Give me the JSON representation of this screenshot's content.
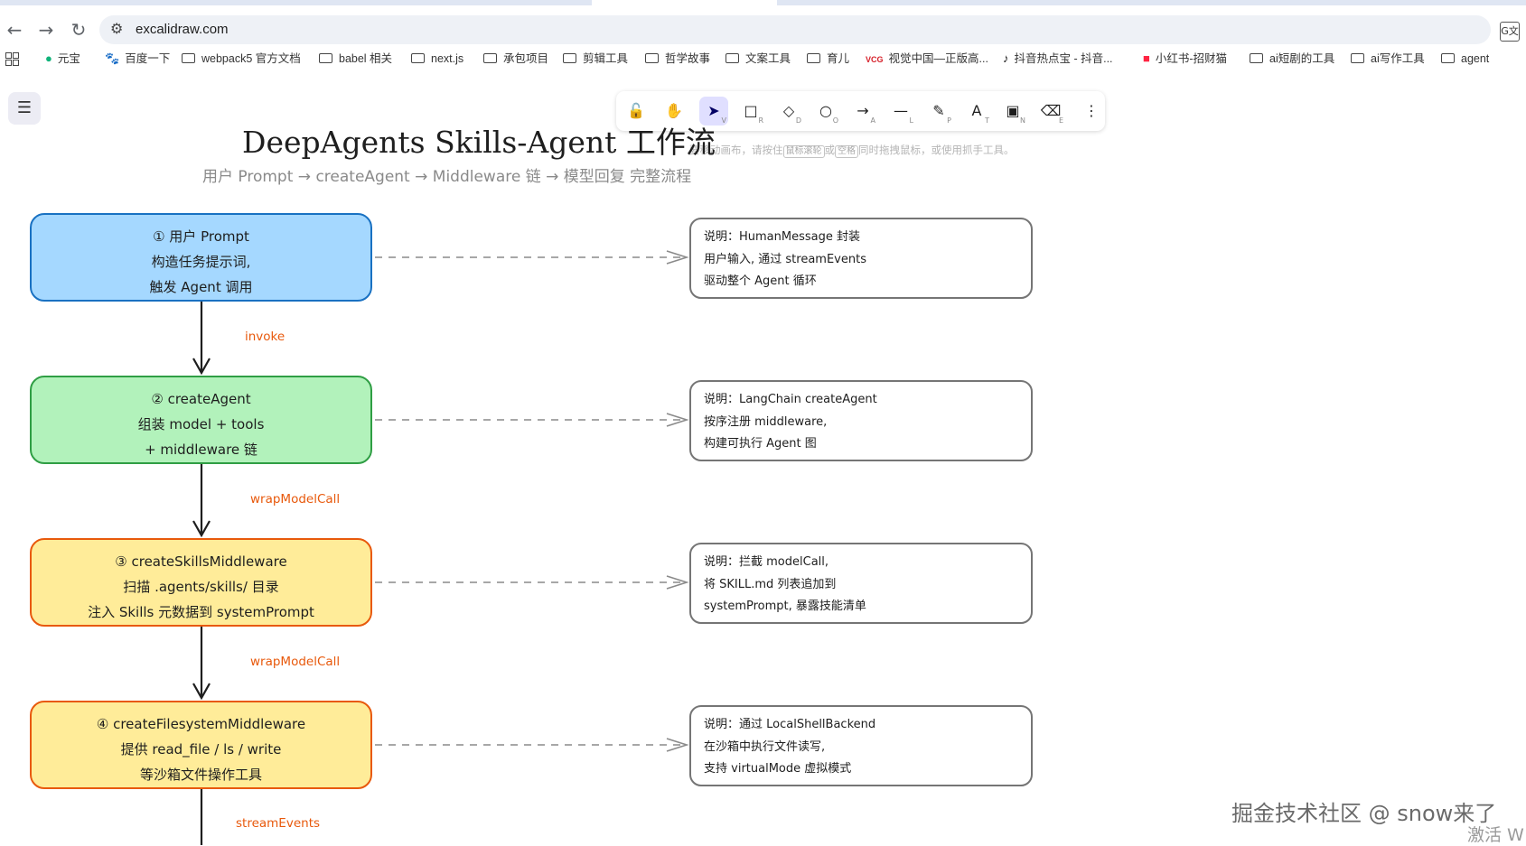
{
  "browser": {
    "url": "excalidraw.com",
    "nav": {
      "back": "←",
      "forward": "→",
      "reload": "↻"
    },
    "translate_icon": "G文",
    "bookmarks": [
      {
        "label": "元宝",
        "icon": "yuanbao-icon"
      },
      {
        "label": "百度一下",
        "icon": "baidu-paw-icon"
      },
      {
        "label": "webpack5 官方文档",
        "icon": "folder-icon"
      },
      {
        "label": "babel 相关",
        "icon": "folder-icon"
      },
      {
        "label": "next.js",
        "icon": "folder-icon"
      },
      {
        "label": "承包项目",
        "icon": "folder-icon"
      },
      {
        "label": "剪辑工具",
        "icon": "folder-icon"
      },
      {
        "label": "哲学故事",
        "icon": "folder-icon"
      },
      {
        "label": "文案工具",
        "icon": "folder-icon"
      },
      {
        "label": "育儿",
        "icon": "folder-icon"
      },
      {
        "label": "视觉中国—正版高...",
        "icon": "vcg-icon",
        "icon_text": "VCG"
      },
      {
        "label": "抖音热点宝 - 抖音...",
        "icon": "douyin-icon"
      },
      {
        "label": "小红书-招财猫",
        "icon": "xiaohongshu-icon"
      },
      {
        "label": "ai短剧的工具",
        "icon": "folder-icon"
      },
      {
        "label": "ai写作工具",
        "icon": "folder-icon"
      },
      {
        "label": "agent",
        "icon": "folder-icon"
      }
    ]
  },
  "toolbar": {
    "tools": [
      {
        "name": "lock",
        "glyph": "🔓",
        "key": ""
      },
      {
        "name": "hand",
        "glyph": "✋",
        "key": ""
      },
      {
        "name": "selection",
        "glyph": "➤",
        "key": "V"
      },
      {
        "name": "rectangle",
        "glyph": "□",
        "key": "R"
      },
      {
        "name": "diamond",
        "glyph": "◇",
        "key": "D"
      },
      {
        "name": "ellipse",
        "glyph": "○",
        "key": "O"
      },
      {
        "name": "arrow",
        "glyph": "→",
        "key": "A"
      },
      {
        "name": "line",
        "glyph": "—",
        "key": "L"
      },
      {
        "name": "draw",
        "glyph": "✎",
        "key": "P"
      },
      {
        "name": "text",
        "glyph": "A",
        "key": "T"
      },
      {
        "name": "image",
        "glyph": "▣",
        "key": "N"
      },
      {
        "name": "eraser",
        "glyph": "⌫",
        "key": "E"
      },
      {
        "name": "more",
        "glyph": "⋮",
        "key": ""
      }
    ],
    "active": "selection",
    "hint_pre": "要移动画布，请按住",
    "hint_key1": "鼠标滚轮",
    "hint_mid": "或",
    "hint_key2": "空格",
    "hint_post": "同时拖拽鼠标，或使用抓手工具。"
  },
  "canvas": {
    "title": "DeepAgents Skills-Agent 工作流",
    "subtitle": "用户 Prompt → createAgent → Middleware 链 → 模型回复 完整流程",
    "steps": [
      {
        "lines": [
          "① 用户 Prompt",
          "构造任务提示词,",
          "触发 Agent 调用"
        ],
        "fill": "#a5d8ff",
        "stroke": "#1971c2"
      },
      {
        "lines": [
          "② createAgent",
          "组装 model + tools",
          "+ middleware 链"
        ],
        "fill": "#b2f2bb",
        "stroke": "#2f9e44"
      },
      {
        "lines": [
          "③ createSkillsMiddleware",
          "扫描 .agents/skills/ 目录",
          "注入 Skills 元数据到 systemPrompt"
        ],
        "fill": "#ffec99",
        "stroke": "#e8590c"
      },
      {
        "lines": [
          "④ createFilesystemMiddleware",
          "提供 read_file / ls / write",
          "等沙箱文件操作工具"
        ],
        "fill": "#ffec99",
        "stroke": "#e8590c"
      }
    ],
    "notes": [
      {
        "lines": [
          "说明：HumanMessage 封装",
          "用户输入, 通过 streamEvents",
          "驱动整个 Agent 循环"
        ]
      },
      {
        "lines": [
          "说明：LangChain createAgent",
          "按序注册 middleware,",
          "构建可执行 Agent 图"
        ]
      },
      {
        "lines": [
          "说明：拦截 modelCall,",
          "将 SKILL.md 列表追加到",
          "systemPrompt, 暴露技能清单"
        ]
      },
      {
        "lines": [
          "说明：通过 LocalShellBackend",
          "在沙箱中执行文件读写,",
          "支持 virtualMode 虚拟模式"
        ]
      }
    ],
    "edge_labels": [
      "invoke",
      "wrapModelCall",
      "wrapModelCall",
      "streamEvents"
    ]
  },
  "overlay": {
    "watermark": "掘金技术社区 @ snow来了",
    "activate": "激活 W"
  }
}
